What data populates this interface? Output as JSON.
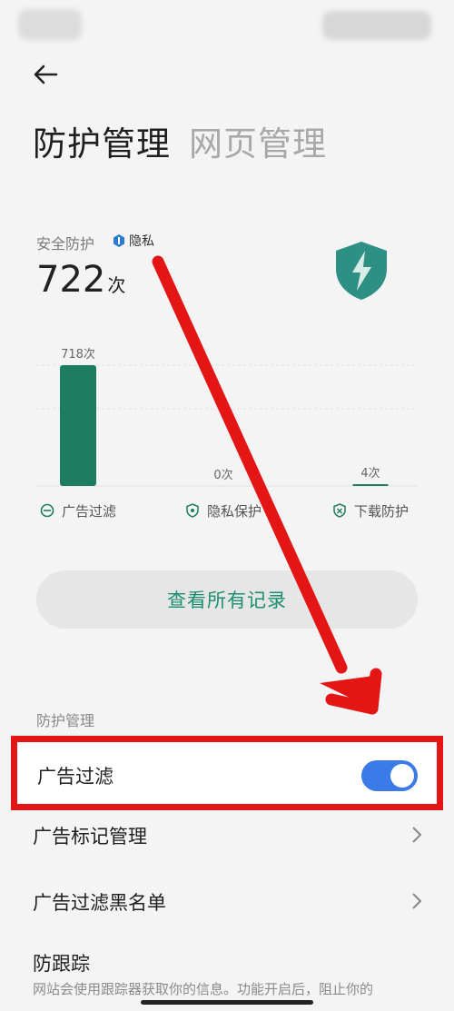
{
  "header": {
    "tabs": [
      {
        "label": "防护管理",
        "active": true
      },
      {
        "label": "网页管理",
        "active": false
      }
    ]
  },
  "summary": {
    "label": "安全防护",
    "badge_label": "隐私",
    "count": "722",
    "count_unit": "次"
  },
  "chart_data": {
    "type": "bar",
    "categories": [
      "广告过滤",
      "隐私保护",
      "下载防护"
    ],
    "values": [
      718,
      0,
      4
    ],
    "value_labels": [
      "718次",
      "0次",
      "4次"
    ],
    "ylim": [
      0,
      718
    ],
    "colors": {
      "bar": "#1e7d61"
    }
  },
  "actions": {
    "view_all": "查看所有记录"
  },
  "management": {
    "section_label": "防护管理",
    "ad_filter": {
      "label": "广告过滤",
      "enabled": true
    },
    "ad_mark": "广告标记管理",
    "ad_blacklist": "广告过滤黑名单",
    "anti_tracking": {
      "label": "防跟踪",
      "desc": "网站会使用跟踪器获取你的信息。功能开启后，阻止你的"
    }
  },
  "colors": {
    "accent": "#1e7d61",
    "toggle_on": "#3a7be8",
    "highlight": "#e41515"
  }
}
